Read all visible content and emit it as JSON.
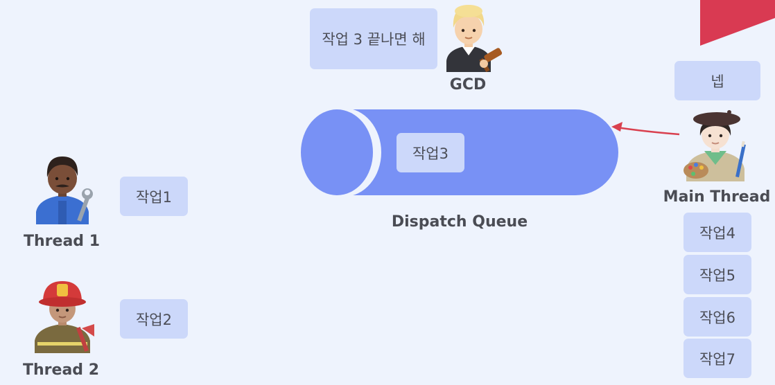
{
  "gcd": {
    "speech": "작업 3 끝나면 해",
    "label": "GCD"
  },
  "main_thread": {
    "reply": "넵",
    "label": "Main Thread",
    "tasks": [
      "작업4",
      "작업5",
      "작업6",
      "작업7"
    ]
  },
  "queue": {
    "label": "Dispatch Queue",
    "task": "작업3"
  },
  "thread1": {
    "label": "Thread 1",
    "task": "작업1"
  },
  "thread2": {
    "label": "Thread 2",
    "task": "작업2"
  },
  "colors": {
    "background": "#eef3fd",
    "task_box": "#ccd8fa",
    "queue_body": "#7891f5",
    "arrow": "#d9404f",
    "corner_flag": "#d93a52"
  },
  "icons": {
    "gcd": "judge-person-icon",
    "main_thread": "artist-woman-icon",
    "thread1": "mechanic-man-icon",
    "thread2": "firefighter-icon"
  }
}
